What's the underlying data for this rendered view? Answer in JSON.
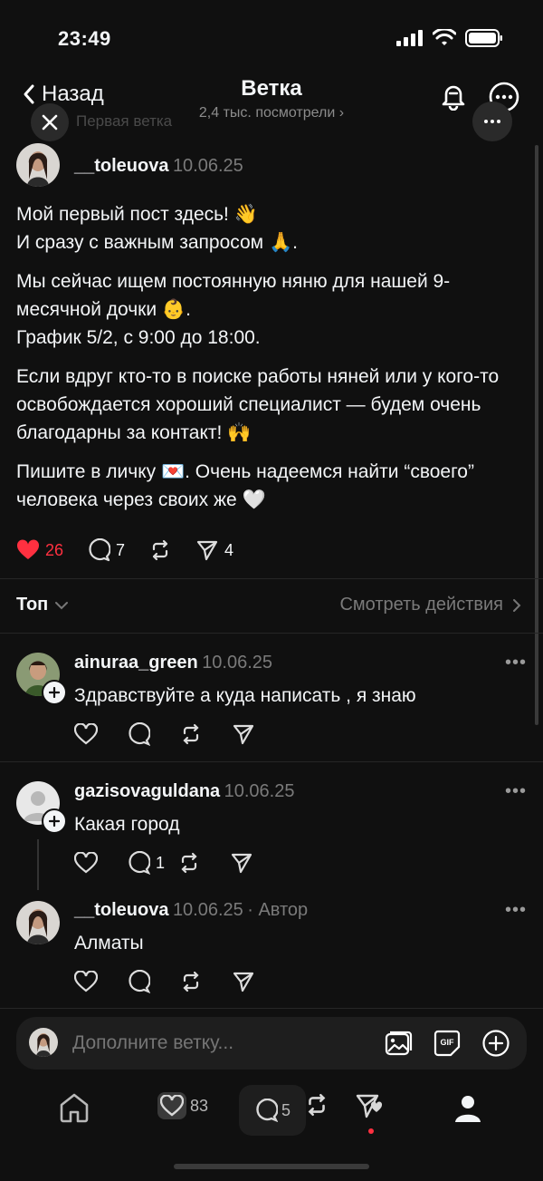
{
  "status": {
    "time": "23:49"
  },
  "header": {
    "back_label": "Назад",
    "title": "Ветка",
    "views": "2,4 тыс. посмотрели",
    "ghost_title": "Первая ветка"
  },
  "post": {
    "username": "__toleuova",
    "date": "10.06.25",
    "paragraphs": [
      "Мой первый пост здесь! 👋",
      "И сразу с важным запросом 🙏.",
      "Мы сейчас ищем постоянную няню для нашей 9-месячной дочки 👶.",
      "График 5/2, с 9:00 до 18:00.",
      "Если вдруг кто-то в поиске работы няней или у кого-то освобождается хороший специалист — будем очень благодарны за контакт! 🙌",
      "Пишите в личку 💌. Очень надеемся найти “своего” человека через своих же 🤍"
    ],
    "likes": "26",
    "comments": "7",
    "shares": "4"
  },
  "sort": {
    "label": "Топ",
    "activity": "Смотреть действия"
  },
  "replies": [
    {
      "username": "ainuraa_green",
      "date": "10.06.25",
      "text": "Здравствуйте а куда написать , я знаю",
      "author_tag": ""
    },
    {
      "username": "gazisovaguldana",
      "date": "10.06.25",
      "text": "Какая город",
      "comments": "1",
      "author_tag": ""
    },
    {
      "username": "__toleuova",
      "date": "10.06.25",
      "author_tag": "· Автор",
      "text": "Алматы"
    }
  ],
  "compose": {
    "placeholder": "Дополните ветку..."
  },
  "tabbar": {
    "activity_count": "83",
    "messages_count": "5"
  },
  "colors": {
    "accent_like": "#ff3040",
    "background": "#101010"
  }
}
